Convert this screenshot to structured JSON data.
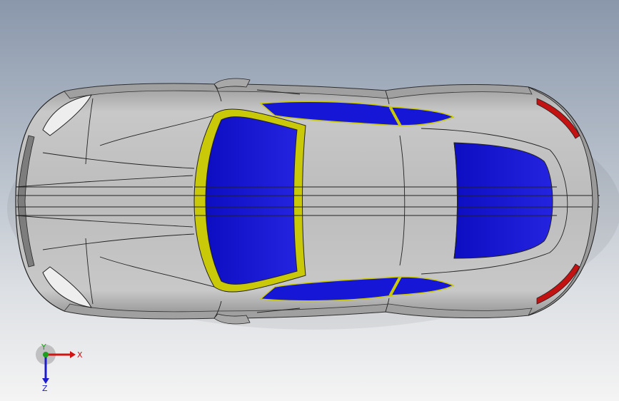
{
  "viewport": {
    "background_top": "#8a97ab",
    "background_bottom": "#f4f4f4"
  },
  "model": {
    "body_color": "#bdbdbd",
    "glass_color": "#1616d6",
    "windshield_frame_color": "#c9c90a",
    "taillight_color": "#c21212"
  },
  "triad": {
    "x_label": "X",
    "y_label": "Y",
    "z_label": "Z",
    "x_color": "#d01414",
    "y_color": "#1ea01e",
    "z_color": "#1c1cc8"
  }
}
